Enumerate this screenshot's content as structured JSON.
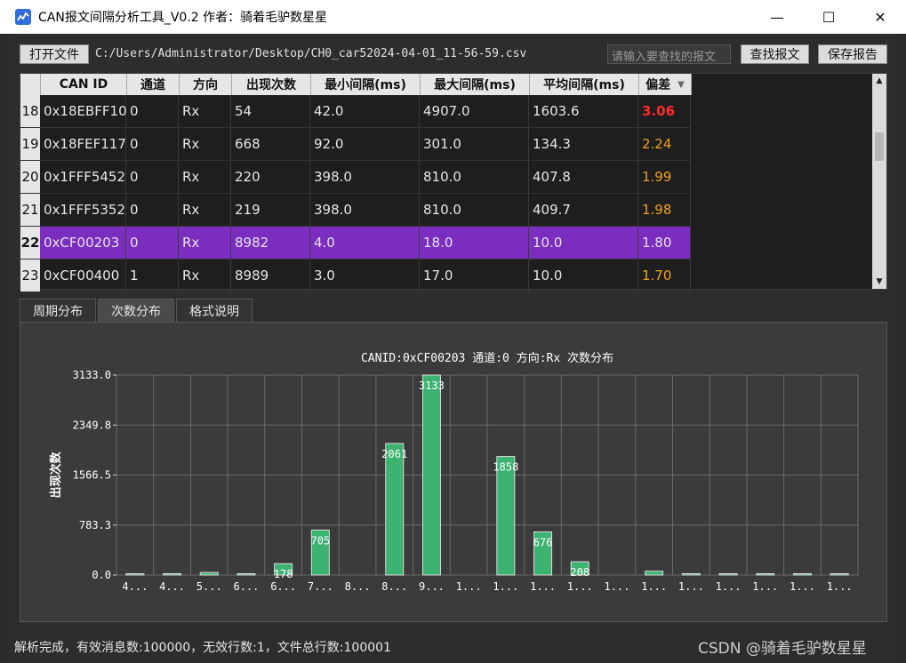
{
  "window": {
    "title": "CAN报文间隔分析工具_V0.2 作者：骑着毛驴数星星",
    "minimize": "—",
    "maximize": "☐",
    "close": "✕"
  },
  "toolbar": {
    "open_label": "打开文件",
    "file_path": "C:/Users/Administrator/Desktop/CH0_car52024-04-01_11-56-59.csv",
    "search_placeholder": "请输入要查找的报文",
    "find_label": "查找报文",
    "save_label": "保存报告"
  },
  "table": {
    "headers": [
      "CAN ID",
      "通道",
      "方向",
      "出现次数",
      "最小间隔(ms)",
      "最大间隔(ms)",
      "平均间隔(ms)",
      "偏差"
    ],
    "rows": [
      {
        "num": "18",
        "id": "0x18EBFF10",
        "ch": "0",
        "dir": "Rx",
        "count": "54",
        "min": "42.0",
        "max": "4907.0",
        "avg": "1603.6",
        "dev": "3.06",
        "dev_color": "#ff2a2a",
        "dev_bold": true
      },
      {
        "num": "19",
        "id": "0x18FEF117",
        "ch": "0",
        "dir": "Rx",
        "count": "668",
        "min": "92.0",
        "max": "301.0",
        "avg": "134.3",
        "dev": "2.24",
        "dev_color": "#f0a020"
      },
      {
        "num": "20",
        "id": "0x1FFF5452",
        "ch": "0",
        "dir": "Rx",
        "count": "220",
        "min": "398.0",
        "max": "810.0",
        "avg": "407.8",
        "dev": "1.99",
        "dev_color": "#f0a020"
      },
      {
        "num": "21",
        "id": "0x1FFF5352",
        "ch": "0",
        "dir": "Rx",
        "count": "219",
        "min": "398.0",
        "max": "810.0",
        "avg": "409.7",
        "dev": "1.98",
        "dev_color": "#f0a020"
      },
      {
        "num": "22",
        "id": "0xCF00203",
        "ch": "0",
        "dir": "Rx",
        "count": "8982",
        "min": "4.0",
        "max": "18.0",
        "avg": "10.0",
        "dev": "1.80",
        "dev_color": "#e6e6e6",
        "selected": true
      },
      {
        "num": "23",
        "id": "0xCF00400",
        "ch": "1",
        "dir": "Rx",
        "count": "8989",
        "min": "3.0",
        "max": "17.0",
        "avg": "10.0",
        "dev": "1.70",
        "dev_color": "#f0a020"
      }
    ],
    "sort_indicator": "▼",
    "scroll_up": "▲",
    "scroll_down": "▼"
  },
  "tabs": [
    {
      "label": "周期分布",
      "active": false
    },
    {
      "label": "次数分布",
      "active": true
    },
    {
      "label": "格式说明",
      "active": false
    }
  ],
  "chart_data": {
    "type": "bar",
    "title": "CANID:0xCF00203 通道:0 方向:Rx 次数分布",
    "ylabel": "出现次数",
    "xlabel": "",
    "ylim": [
      0,
      3133.0
    ],
    "yticks": [
      "0.0",
      "783.3",
      "1566.5",
      "2349.8",
      "3133.0"
    ],
    "categories": [
      "4...",
      "4...",
      "5...",
      "6...",
      "6...",
      "7...",
      "8...",
      "8...",
      "9...",
      "1...",
      "1...",
      "1...",
      "1...",
      "1...",
      "1...",
      "1...",
      "1...",
      "1...",
      "1...",
      "1..."
    ],
    "values": [
      8,
      15,
      40,
      3,
      178,
      705,
      0,
      2061,
      3133,
      0,
      1858,
      676,
      208,
      0,
      60,
      12,
      3,
      10,
      6,
      8
    ],
    "labels": [
      "",
      "",
      "",
      "",
      "178",
      "705",
      "",
      "2061",
      "3133",
      "",
      "1858",
      "676",
      "208",
      "",
      "",
      "",
      "",
      "",
      "",
      ""
    ],
    "bar_color": "#3cb371",
    "grid": true
  },
  "status": {
    "text": "解析完成，有效消息数:100000，无效行数:1，文件总行数:100001"
  },
  "watermark": "CSDN @骑着毛驴数星星"
}
